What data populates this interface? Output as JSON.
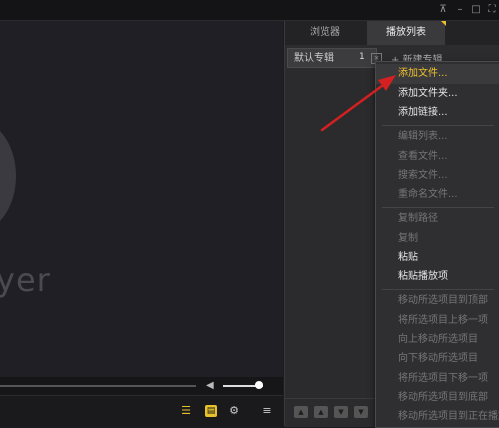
{
  "window": {
    "pin_glyph": "⊼",
    "minimize_glyph": "–",
    "maximize_glyph": "□",
    "fullscreen_glyph": "⛶"
  },
  "video": {
    "logo_text": "yer"
  },
  "seek": {
    "volume_icon_glyph": "◀",
    "volume_level": 0.9
  },
  "toolbar": {
    "search_glyph": "☰",
    "playlist_glyph": "▤",
    "settings_glyph": "⚙",
    "menu_glyph": "≡"
  },
  "playlist_panel": {
    "tab_browser": "浏览器",
    "tab_playlist": "播放列表",
    "album_name": "默认专辑",
    "album_count": "1",
    "album_close": "×",
    "new_album": "+ 新建专辑",
    "nav": [
      "▲",
      "▲",
      "▼",
      "▼"
    ]
  },
  "context_menu": {
    "items": [
      {
        "label": "添加文件...",
        "state": "highlighted"
      },
      {
        "label": "添加文件夹...",
        "state": "enabled"
      },
      {
        "label": "添加链接...",
        "state": "enabled"
      },
      {
        "label": "编辑列表...",
        "state": "disabled"
      },
      {
        "label": "查看文件...",
        "state": "disabled"
      },
      {
        "label": "搜索文件...",
        "state": "disabled"
      },
      {
        "label": "重命名文件...",
        "state": "disabled"
      },
      {
        "label": "复制路径",
        "state": "disabled"
      },
      {
        "label": "复制",
        "state": "disabled"
      },
      {
        "label": "粘贴",
        "state": "enabled"
      },
      {
        "label": "粘贴播放项",
        "state": "enabled"
      },
      {
        "label": "移动所选项目到顶部",
        "state": "disabled"
      },
      {
        "label": "将所选项目上移一项",
        "state": "disabled"
      },
      {
        "label": "向上移动所选项目",
        "state": "disabled"
      },
      {
        "label": "向下移动所选项目",
        "state": "disabled"
      },
      {
        "label": "将所选项目下移一项",
        "state": "disabled"
      },
      {
        "label": "移动所选项目到底部",
        "state": "disabled"
      },
      {
        "label": "移动所选项目到正在播放",
        "state": "disabled"
      }
    ]
  },
  "colors": {
    "accent": "#f2c12e",
    "arrow": "#d42020"
  }
}
